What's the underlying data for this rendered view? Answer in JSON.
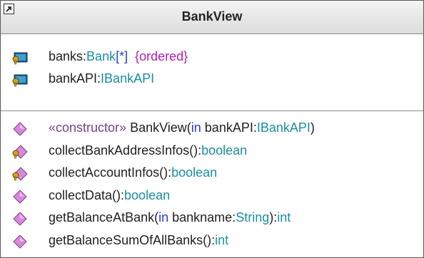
{
  "class": {
    "name": "BankView",
    "collapse_icon": "collapse-arrow-icon"
  },
  "attributes": [
    {
      "icon": "private-property-key-icon",
      "parts": [
        {
          "t": "banks:",
          "c": "default"
        },
        {
          "t": "Bank",
          "c": "type"
        },
        {
          "t": "[*]",
          "c": "keyword"
        },
        {
          "t": "  ",
          "c": "default"
        },
        {
          "t": "{ordered}",
          "c": "constraint"
        }
      ]
    },
    {
      "icon": "private-property-key-icon",
      "parts": [
        {
          "t": "bankAPI:",
          "c": "default"
        },
        {
          "t": "IBankAPI",
          "c": "type"
        }
      ]
    }
  ],
  "operations": [
    {
      "icon": "public-operation-diamond-icon",
      "parts": [
        {
          "t": "«constructor» ",
          "c": "stereo"
        },
        {
          "t": "BankView(",
          "c": "default"
        },
        {
          "t": "in",
          "c": "keyword"
        },
        {
          "t": " bankAPI:",
          "c": "default"
        },
        {
          "t": "IBankAPI",
          "c": "type"
        },
        {
          "t": ")",
          "c": "default"
        }
      ]
    },
    {
      "icon": "private-operation-key-icon",
      "parts": [
        {
          "t": "collectBankAddressInfos():",
          "c": "default"
        },
        {
          "t": "boolean",
          "c": "type"
        }
      ]
    },
    {
      "icon": "private-operation-key-icon",
      "parts": [
        {
          "t": "collectAccountInfos():",
          "c": "default"
        },
        {
          "t": "boolean",
          "c": "type"
        }
      ]
    },
    {
      "icon": "public-operation-diamond-icon",
      "parts": [
        {
          "t": "collectData():",
          "c": "default"
        },
        {
          "t": "boolean",
          "c": "type"
        }
      ]
    },
    {
      "icon": "public-operation-diamond-icon",
      "parts": [
        {
          "t": "getBalanceAtBank(",
          "c": "default"
        },
        {
          "t": "in",
          "c": "keyword"
        },
        {
          "t": " bankname:",
          "c": "default"
        },
        {
          "t": "String",
          "c": "type"
        },
        {
          "t": "):",
          "c": "default"
        },
        {
          "t": "int",
          "c": "type"
        }
      ]
    },
    {
      "icon": "public-operation-diamond-icon",
      "parts": [
        {
          "t": "getBalanceSumOfAllBanks():",
          "c": "default"
        },
        {
          "t": "int",
          "c": "type"
        }
      ]
    }
  ],
  "colors": {
    "default": "#1f1f1f",
    "type": "#1a8fa0",
    "keyword": "#2b3bd0",
    "stereo": "#7a3d8f",
    "constraint": "#b01fb0",
    "diamond": "#d58ad8",
    "key": "#d8a020"
  }
}
